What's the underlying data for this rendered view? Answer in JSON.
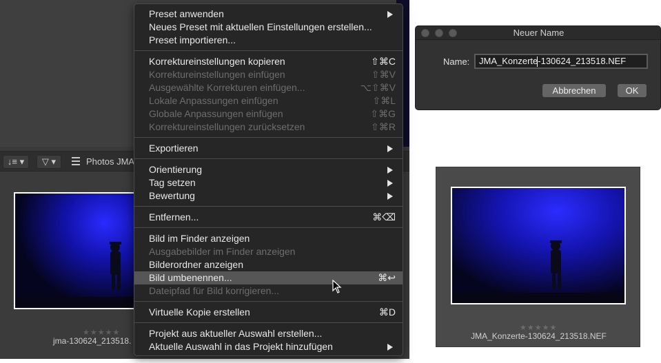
{
  "app": {
    "filmstrip": {
      "sort_icon": "sort-icon",
      "sort_glyph": "↓≡ ▾",
      "filter_icon": "filter-icon",
      "filter_glyph": "▽ ▾",
      "grid_icon": "grid-view-icon",
      "project_label": "Photos JMA"
    },
    "thumbnail": {
      "stars": "★★★★★",
      "filename": "jma-130624_213518."
    }
  },
  "context_menu": {
    "groups": [
      [
        {
          "label": "Preset anwenden",
          "submenu": true,
          "enabled": true
        },
        {
          "label": "Neues Preset mit aktuellen Einstellungen erstellen...",
          "enabled": true
        },
        {
          "label": "Preset importieren...",
          "enabled": true
        }
      ],
      [
        {
          "label": "Korrektureinstellungen kopieren",
          "shortcut": "⇧⌘C",
          "enabled": true
        },
        {
          "label": "Korrektureinstellungen einfügen",
          "shortcut": "⇧⌘V",
          "enabled": false
        },
        {
          "label": "Ausgewählte Korrekturen einfügen...",
          "shortcut": "⌥⇧⌘V",
          "enabled": false
        },
        {
          "label": "Lokale Anpassungen einfügen",
          "shortcut": "⇧⌘L",
          "enabled": false
        },
        {
          "label": "Globale Anpassungen einfügen",
          "shortcut": "⇧⌘G",
          "enabled": false
        },
        {
          "label": "Korrektureinstellungen zurücksetzen",
          "shortcut": "⇧⌘R",
          "enabled": false
        }
      ],
      [
        {
          "label": "Exportieren",
          "submenu": true,
          "enabled": true
        }
      ],
      [
        {
          "label": "Orientierung",
          "submenu": true,
          "enabled": true
        },
        {
          "label": "Tag setzen",
          "submenu": true,
          "enabled": true
        },
        {
          "label": "Bewertung",
          "submenu": true,
          "enabled": true
        }
      ],
      [
        {
          "label": "Entfernen...",
          "shortcut": "⌘⌫",
          "enabled": true
        }
      ],
      [
        {
          "label": "Bild im Finder anzeigen",
          "enabled": true
        },
        {
          "label": "Ausgabebilder im Finder anzeigen",
          "enabled": false
        },
        {
          "label": "Bilderordner anzeigen",
          "enabled": true
        },
        {
          "label": "Bild umbenennen...",
          "shortcut": "⌘↩",
          "enabled": true,
          "highlighted": true
        },
        {
          "label": "Dateipfad für Bild korrigieren...",
          "enabled": false
        }
      ],
      [
        {
          "label": "Virtuelle Kopie erstellen",
          "shortcut": "⌘D",
          "enabled": true
        }
      ],
      [
        {
          "label": "Projekt aus aktueller Auswahl erstellen...",
          "enabled": true
        },
        {
          "label": "Aktuelle Auswahl in das Projekt hinzufügen",
          "submenu": true,
          "enabled": true
        }
      ]
    ]
  },
  "rename_dialog": {
    "title": "Neuer Name",
    "name_label": "Name:",
    "name_value": "JMA_Konzerte-130624_213518.NEF",
    "cancel_label": "Abbrechen",
    "ok_label": "OK"
  },
  "preview": {
    "stars": "★★★★★",
    "filename": "JMA_Konzerte-130624_213518.NEF"
  },
  "colors": {
    "menu_bg": "#262626",
    "menu_highlight": "#565656",
    "menu_text": "#e9e9e9",
    "menu_disabled": "#6d6d6d",
    "dialog_bg": "#323232",
    "button_bg": "#656565",
    "photo_blue": "#1a1adf"
  }
}
